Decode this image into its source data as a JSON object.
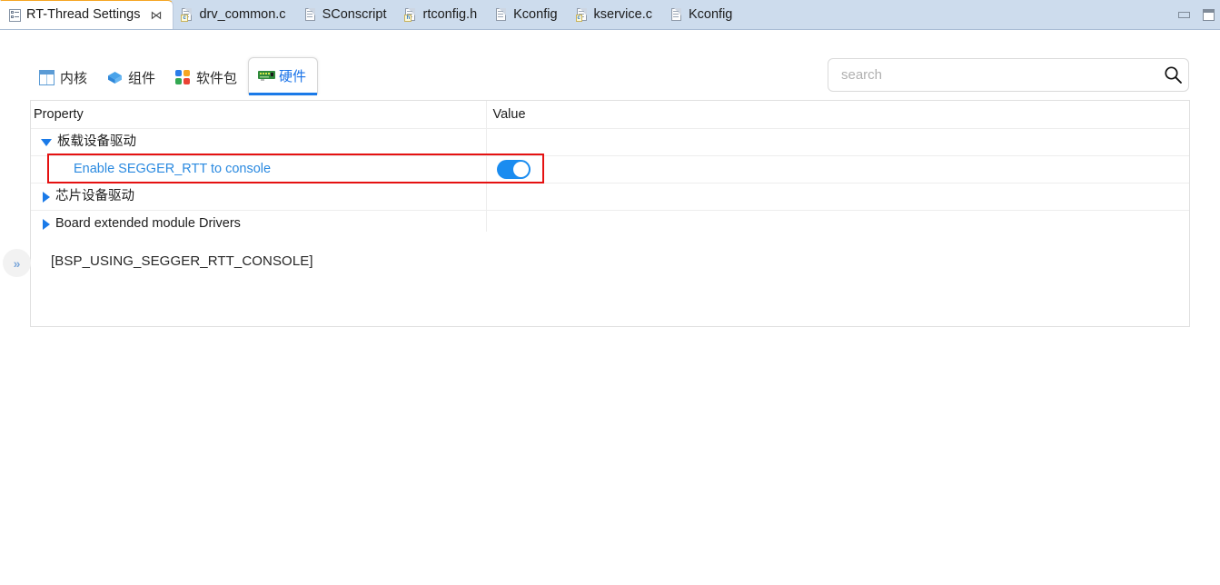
{
  "window": {
    "minimize_label": "minimize",
    "maximize_label": "maximize"
  },
  "editor_tabs": [
    {
      "label": "RT-Thread Settings",
      "icon": "settings-icon",
      "active": true,
      "close": "⋈"
    },
    {
      "label": "drv_common.c",
      "icon": "c-file-icon",
      "active": false
    },
    {
      "label": "SConscript",
      "icon": "text-file-icon",
      "active": false
    },
    {
      "label": "rtconfig.h",
      "icon": "h-file-icon",
      "active": false
    },
    {
      "label": "Kconfig",
      "icon": "text-file-icon",
      "active": false
    },
    {
      "label": "kservice.c",
      "icon": "c-file-icon",
      "active": false
    },
    {
      "label": "Kconfig",
      "icon": "text-file-icon",
      "active": false
    }
  ],
  "nav_tabs": [
    {
      "label": "内核",
      "icon": "kernel-icon",
      "selected": false
    },
    {
      "label": "组件",
      "icon": "components-cube-icon",
      "selected": false
    },
    {
      "label": "软件包",
      "icon": "packages-clover-icon",
      "selected": false
    },
    {
      "label": "硬件",
      "icon": "hardware-board-icon",
      "selected": true
    }
  ],
  "search": {
    "placeholder": "search",
    "value": "",
    "icon": "search-icon"
  },
  "table": {
    "headers": {
      "property": "Property",
      "value": "Value"
    },
    "rows": [
      {
        "label": "板载设备驱动",
        "level": 0,
        "expander": "down",
        "value_type": "none"
      },
      {
        "label": "Enable SEGGER_RTT to console",
        "level": 1,
        "expander": "none",
        "value_type": "toggle",
        "toggle_on": true,
        "highlighted": true
      },
      {
        "label": "芯片设备驱动",
        "level": 0,
        "expander": "right",
        "value_type": "none"
      },
      {
        "label": "Board extended module Drivers",
        "level": 0,
        "expander": "right",
        "value_type": "none"
      }
    ]
  },
  "description": {
    "text": "[BSP_USING_SEGGER_RTT_CONSOLE]"
  },
  "restore_button": {
    "label": "»",
    "name": "restore-view-button"
  },
  "colors": {
    "accent_blue": "#1a7ae8",
    "toggle_on": "#1a8cf0",
    "highlight_red": "#e51111",
    "tabbar_bg": "#cddced",
    "child_link": "#2b8ae0"
  }
}
